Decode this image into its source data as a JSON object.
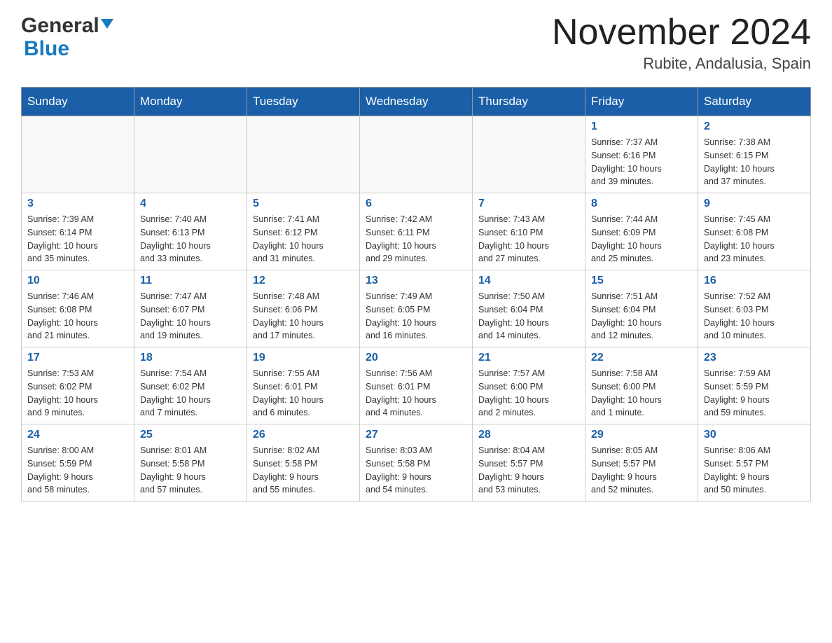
{
  "header": {
    "logo_general": "General",
    "logo_blue": "Blue",
    "month_title": "November 2024",
    "location": "Rubite, Andalusia, Spain"
  },
  "weekdays": [
    "Sunday",
    "Monday",
    "Tuesday",
    "Wednesday",
    "Thursday",
    "Friday",
    "Saturday"
  ],
  "weeks": [
    [
      {
        "day": "",
        "info": ""
      },
      {
        "day": "",
        "info": ""
      },
      {
        "day": "",
        "info": ""
      },
      {
        "day": "",
        "info": ""
      },
      {
        "day": "",
        "info": ""
      },
      {
        "day": "1",
        "info": "Sunrise: 7:37 AM\nSunset: 6:16 PM\nDaylight: 10 hours\nand 39 minutes."
      },
      {
        "day": "2",
        "info": "Sunrise: 7:38 AM\nSunset: 6:15 PM\nDaylight: 10 hours\nand 37 minutes."
      }
    ],
    [
      {
        "day": "3",
        "info": "Sunrise: 7:39 AM\nSunset: 6:14 PM\nDaylight: 10 hours\nand 35 minutes."
      },
      {
        "day": "4",
        "info": "Sunrise: 7:40 AM\nSunset: 6:13 PM\nDaylight: 10 hours\nand 33 minutes."
      },
      {
        "day": "5",
        "info": "Sunrise: 7:41 AM\nSunset: 6:12 PM\nDaylight: 10 hours\nand 31 minutes."
      },
      {
        "day": "6",
        "info": "Sunrise: 7:42 AM\nSunset: 6:11 PM\nDaylight: 10 hours\nand 29 minutes."
      },
      {
        "day": "7",
        "info": "Sunrise: 7:43 AM\nSunset: 6:10 PM\nDaylight: 10 hours\nand 27 minutes."
      },
      {
        "day": "8",
        "info": "Sunrise: 7:44 AM\nSunset: 6:09 PM\nDaylight: 10 hours\nand 25 minutes."
      },
      {
        "day": "9",
        "info": "Sunrise: 7:45 AM\nSunset: 6:08 PM\nDaylight: 10 hours\nand 23 minutes."
      }
    ],
    [
      {
        "day": "10",
        "info": "Sunrise: 7:46 AM\nSunset: 6:08 PM\nDaylight: 10 hours\nand 21 minutes."
      },
      {
        "day": "11",
        "info": "Sunrise: 7:47 AM\nSunset: 6:07 PM\nDaylight: 10 hours\nand 19 minutes."
      },
      {
        "day": "12",
        "info": "Sunrise: 7:48 AM\nSunset: 6:06 PM\nDaylight: 10 hours\nand 17 minutes."
      },
      {
        "day": "13",
        "info": "Sunrise: 7:49 AM\nSunset: 6:05 PM\nDaylight: 10 hours\nand 16 minutes."
      },
      {
        "day": "14",
        "info": "Sunrise: 7:50 AM\nSunset: 6:04 PM\nDaylight: 10 hours\nand 14 minutes."
      },
      {
        "day": "15",
        "info": "Sunrise: 7:51 AM\nSunset: 6:04 PM\nDaylight: 10 hours\nand 12 minutes."
      },
      {
        "day": "16",
        "info": "Sunrise: 7:52 AM\nSunset: 6:03 PM\nDaylight: 10 hours\nand 10 minutes."
      }
    ],
    [
      {
        "day": "17",
        "info": "Sunrise: 7:53 AM\nSunset: 6:02 PM\nDaylight: 10 hours\nand 9 minutes."
      },
      {
        "day": "18",
        "info": "Sunrise: 7:54 AM\nSunset: 6:02 PM\nDaylight: 10 hours\nand 7 minutes."
      },
      {
        "day": "19",
        "info": "Sunrise: 7:55 AM\nSunset: 6:01 PM\nDaylight: 10 hours\nand 6 minutes."
      },
      {
        "day": "20",
        "info": "Sunrise: 7:56 AM\nSunset: 6:01 PM\nDaylight: 10 hours\nand 4 minutes."
      },
      {
        "day": "21",
        "info": "Sunrise: 7:57 AM\nSunset: 6:00 PM\nDaylight: 10 hours\nand 2 minutes."
      },
      {
        "day": "22",
        "info": "Sunrise: 7:58 AM\nSunset: 6:00 PM\nDaylight: 10 hours\nand 1 minute."
      },
      {
        "day": "23",
        "info": "Sunrise: 7:59 AM\nSunset: 5:59 PM\nDaylight: 9 hours\nand 59 minutes."
      }
    ],
    [
      {
        "day": "24",
        "info": "Sunrise: 8:00 AM\nSunset: 5:59 PM\nDaylight: 9 hours\nand 58 minutes."
      },
      {
        "day": "25",
        "info": "Sunrise: 8:01 AM\nSunset: 5:58 PM\nDaylight: 9 hours\nand 57 minutes."
      },
      {
        "day": "26",
        "info": "Sunrise: 8:02 AM\nSunset: 5:58 PM\nDaylight: 9 hours\nand 55 minutes."
      },
      {
        "day": "27",
        "info": "Sunrise: 8:03 AM\nSunset: 5:58 PM\nDaylight: 9 hours\nand 54 minutes."
      },
      {
        "day": "28",
        "info": "Sunrise: 8:04 AM\nSunset: 5:57 PM\nDaylight: 9 hours\nand 53 minutes."
      },
      {
        "day": "29",
        "info": "Sunrise: 8:05 AM\nSunset: 5:57 PM\nDaylight: 9 hours\nand 52 minutes."
      },
      {
        "day": "30",
        "info": "Sunrise: 8:06 AM\nSunset: 5:57 PM\nDaylight: 9 hours\nand 50 minutes."
      }
    ]
  ]
}
